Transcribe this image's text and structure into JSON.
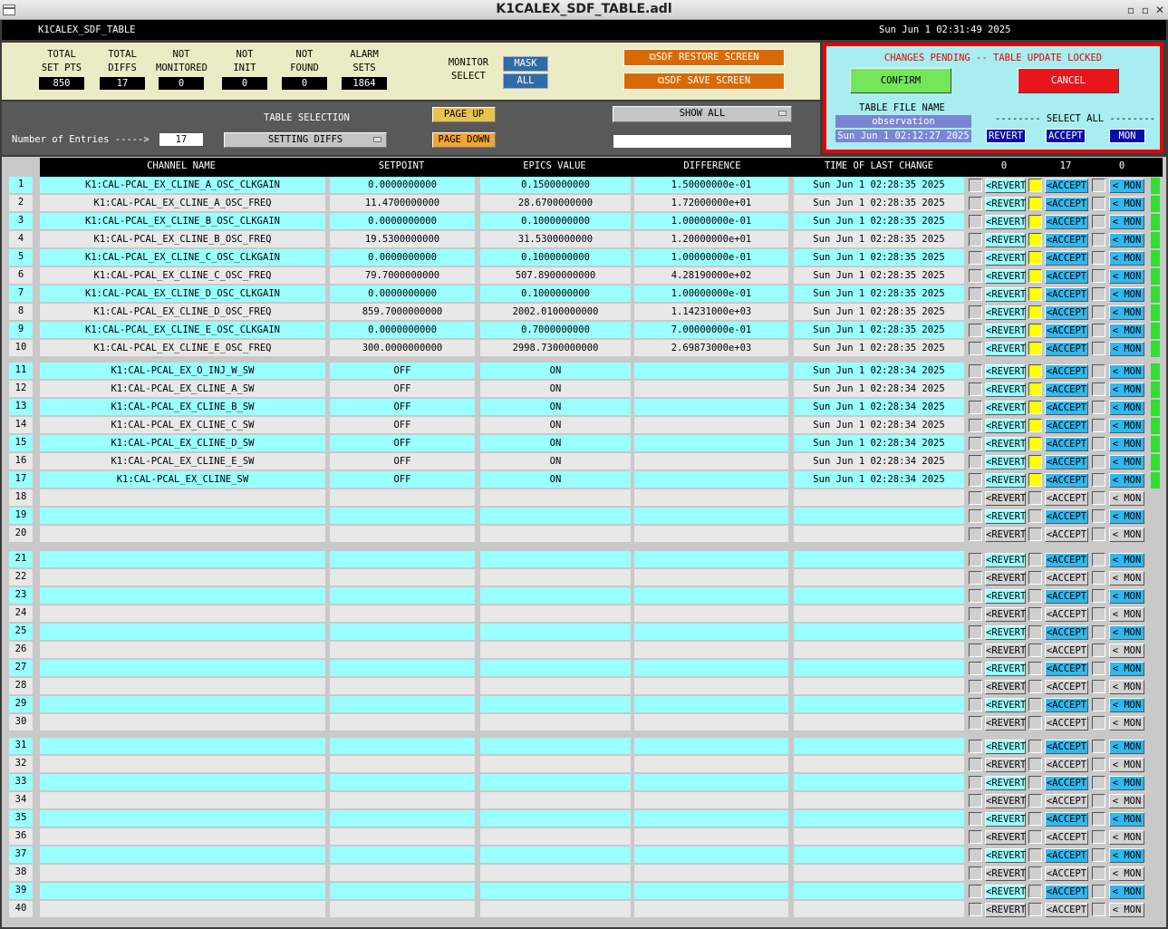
{
  "window": {
    "title": "K1CALEX_SDF_TABLE.adl"
  },
  "topbar": {
    "screen_name": "K1CALEX_SDF_TABLE",
    "datetime": "Sun Jun  1 02:31:49 2025"
  },
  "summary": {
    "stats": [
      {
        "line1": "TOTAL",
        "line2": "SET PTS",
        "value": "850"
      },
      {
        "line1": "TOTAL",
        "line2": "DIFFS",
        "value": "17"
      },
      {
        "line1": "NOT",
        "line2": "MONITORED",
        "value": "0"
      },
      {
        "line1": "NOT",
        "line2": "INIT",
        "value": "0"
      },
      {
        "line1": "NOT",
        "line2": "FOUND",
        "value": "0"
      },
      {
        "line1": "ALARM",
        "line2": "SETS",
        "value": "1864"
      }
    ],
    "monitor_select_line1": "MONITOR",
    "monitor_select_line2": "SELECT",
    "mask_label": "MASK",
    "all_label": "ALL",
    "restore_label": "SDF RESTORE SCREEN",
    "save_label": "SDF SAVE SCREEN"
  },
  "controls": {
    "entries_label": "Number of Entries ----->",
    "entries_value": "17",
    "table_selection_label": "TABLE SELECTION",
    "table_selection_value": "SETTING DIFFS",
    "page_up": "PAGE UP",
    "page_down": "PAGE DOWN",
    "show_all": "SHOW ALL",
    "filter_text": ""
  },
  "pending": {
    "message": "CHANGES PENDING -- TABLE UPDATE LOCKED",
    "confirm": "CONFIRM",
    "cancel": "CANCEL",
    "table_file_label": "TABLE FILE NAME",
    "table_file_value": "observation",
    "table_file_time": "Sun Jun  1 02:12:27 2025",
    "select_all_label": "-------- SELECT ALL --------",
    "revert": "REVERT",
    "accept": "ACCEPT",
    "mon": "MON"
  },
  "table": {
    "headers": {
      "channel": "CHANNEL NAME",
      "setpoint": "SETPOINT",
      "epics": "EPICS VALUE",
      "difference": "DIFFERENCE",
      "time": "TIME OF LAST CHANGE",
      "count_revert": "0",
      "count_accept": "17",
      "count_mon": "0"
    },
    "button_labels": {
      "revert": "<REVERT",
      "accept": "<ACCEPT",
      "mon": "< MON"
    },
    "rows": [
      {
        "n": "1",
        "channel": "K1:CAL-PCAL_EX_CLINE_A_OSC_CLKGAIN",
        "setpoint": "0.0000000000",
        "epics": "0.1500000000",
        "diff": "1.50000000e-01",
        "time": "Sun Jun  1 02:28:35 2025",
        "accept": true
      },
      {
        "n": "2",
        "channel": "K1:CAL-PCAL_EX_CLINE_A_OSC_FREQ",
        "setpoint": "11.4700000000",
        "epics": "28.6700000000",
        "diff": "1.72000000e+01",
        "time": "Sun Jun  1 02:28:35 2025",
        "accept": true
      },
      {
        "n": "3",
        "channel": "K1:CAL-PCAL_EX_CLINE_B_OSC_CLKGAIN",
        "setpoint": "0.0000000000",
        "epics": "0.1000000000",
        "diff": "1.00000000e-01",
        "time": "Sun Jun  1 02:28:35 2025",
        "accept": true
      },
      {
        "n": "4",
        "channel": "K1:CAL-PCAL_EX_CLINE_B_OSC_FREQ",
        "setpoint": "19.5300000000",
        "epics": "31.5300000000",
        "diff": "1.20000000e+01",
        "time": "Sun Jun  1 02:28:35 2025",
        "accept": true
      },
      {
        "n": "5",
        "channel": "K1:CAL-PCAL_EX_CLINE_C_OSC_CLKGAIN",
        "setpoint": "0.0000000000",
        "epics": "0.1000000000",
        "diff": "1.00000000e-01",
        "time": "Sun Jun  1 02:28:35 2025",
        "accept": true
      },
      {
        "n": "6",
        "channel": "K1:CAL-PCAL_EX_CLINE_C_OSC_FREQ",
        "setpoint": "79.7000000000",
        "epics": "507.8900000000",
        "diff": "4.28190000e+02",
        "time": "Sun Jun  1 02:28:35 2025",
        "accept": true
      },
      {
        "n": "7",
        "channel": "K1:CAL-PCAL_EX_CLINE_D_OSC_CLKGAIN",
        "setpoint": "0.0000000000",
        "epics": "0.1000000000",
        "diff": "1.00000000e-01",
        "time": "Sun Jun  1 02:28:35 2025",
        "accept": true
      },
      {
        "n": "8",
        "channel": "K1:CAL-PCAL_EX_CLINE_D_OSC_FREQ",
        "setpoint": "859.7000000000",
        "epics": "2002.0100000000",
        "diff": "1.14231000e+03",
        "time": "Sun Jun  1 02:28:35 2025",
        "accept": true
      },
      {
        "n": "9",
        "channel": "K1:CAL-PCAL_EX_CLINE_E_OSC_CLKGAIN",
        "setpoint": "0.0000000000",
        "epics": "0.7000000000",
        "diff": "7.00000000e-01",
        "time": "Sun Jun  1 02:28:35 2025",
        "accept": true
      },
      {
        "n": "10",
        "channel": "K1:CAL-PCAL_EX_CLINE_E_OSC_FREQ",
        "setpoint": "300.0000000000",
        "epics": "2998.7300000000",
        "diff": "2.69873000e+03",
        "time": "Sun Jun  1 02:28:35 2025",
        "accept": true
      },
      {
        "n": "11",
        "channel": "K1:CAL-PCAL_EX_O_INJ_W_SW",
        "setpoint": "OFF",
        "epics": "ON",
        "diff": "",
        "time": "Sun Jun  1 02:28:34 2025",
        "accept": true
      },
      {
        "n": "12",
        "channel": "K1:CAL-PCAL_EX_CLINE_A_SW",
        "setpoint": "OFF",
        "epics": "ON",
        "diff": "",
        "time": "Sun Jun  1 02:28:34 2025",
        "accept": true
      },
      {
        "n": "13",
        "channel": "K1:CAL-PCAL_EX_CLINE_B_SW",
        "setpoint": "OFF",
        "epics": "ON",
        "diff": "",
        "time": "Sun Jun  1 02:28:34 2025",
        "accept": true
      },
      {
        "n": "14",
        "channel": "K1:CAL-PCAL_EX_CLINE_C_SW",
        "setpoint": "OFF",
        "epics": "ON",
        "diff": "",
        "time": "Sun Jun  1 02:28:34 2025",
        "accept": true
      },
      {
        "n": "15",
        "channel": "K1:CAL-PCAL_EX_CLINE_D_SW",
        "setpoint": "OFF",
        "epics": "ON",
        "diff": "",
        "time": "Sun Jun  1 02:28:34 2025",
        "accept": true
      },
      {
        "n": "16",
        "channel": "K1:CAL-PCAL_EX_CLINE_E_SW",
        "setpoint": "OFF",
        "epics": "ON",
        "diff": "",
        "time": "Sun Jun  1 02:28:34 2025",
        "accept": true
      },
      {
        "n": "17",
        "channel": "K1:CAL-PCAL_EX_CLINE_SW",
        "setpoint": "OFF",
        "epics": "ON",
        "diff": "",
        "time": "Sun Jun  1 02:28:34 2025",
        "accept": true
      },
      {
        "n": "18"
      },
      {
        "n": "19"
      },
      {
        "n": "20"
      },
      {
        "n": "21"
      },
      {
        "n": "22"
      },
      {
        "n": "23"
      },
      {
        "n": "24"
      },
      {
        "n": "25"
      },
      {
        "n": "26"
      },
      {
        "n": "27"
      },
      {
        "n": "28"
      },
      {
        "n": "29"
      },
      {
        "n": "30"
      },
      {
        "n": "31"
      },
      {
        "n": "32"
      },
      {
        "n": "33"
      },
      {
        "n": "34"
      },
      {
        "n": "35"
      },
      {
        "n": "36"
      },
      {
        "n": "37"
      },
      {
        "n": "38"
      },
      {
        "n": "39"
      },
      {
        "n": "40"
      }
    ]
  },
  "colors": {
    "cyan_row": "#99ffff",
    "gray_row": "#e8e8e8",
    "accept_yellow": "#ffff00",
    "status_green": "#33dd33",
    "pending_border": "#e80000"
  }
}
